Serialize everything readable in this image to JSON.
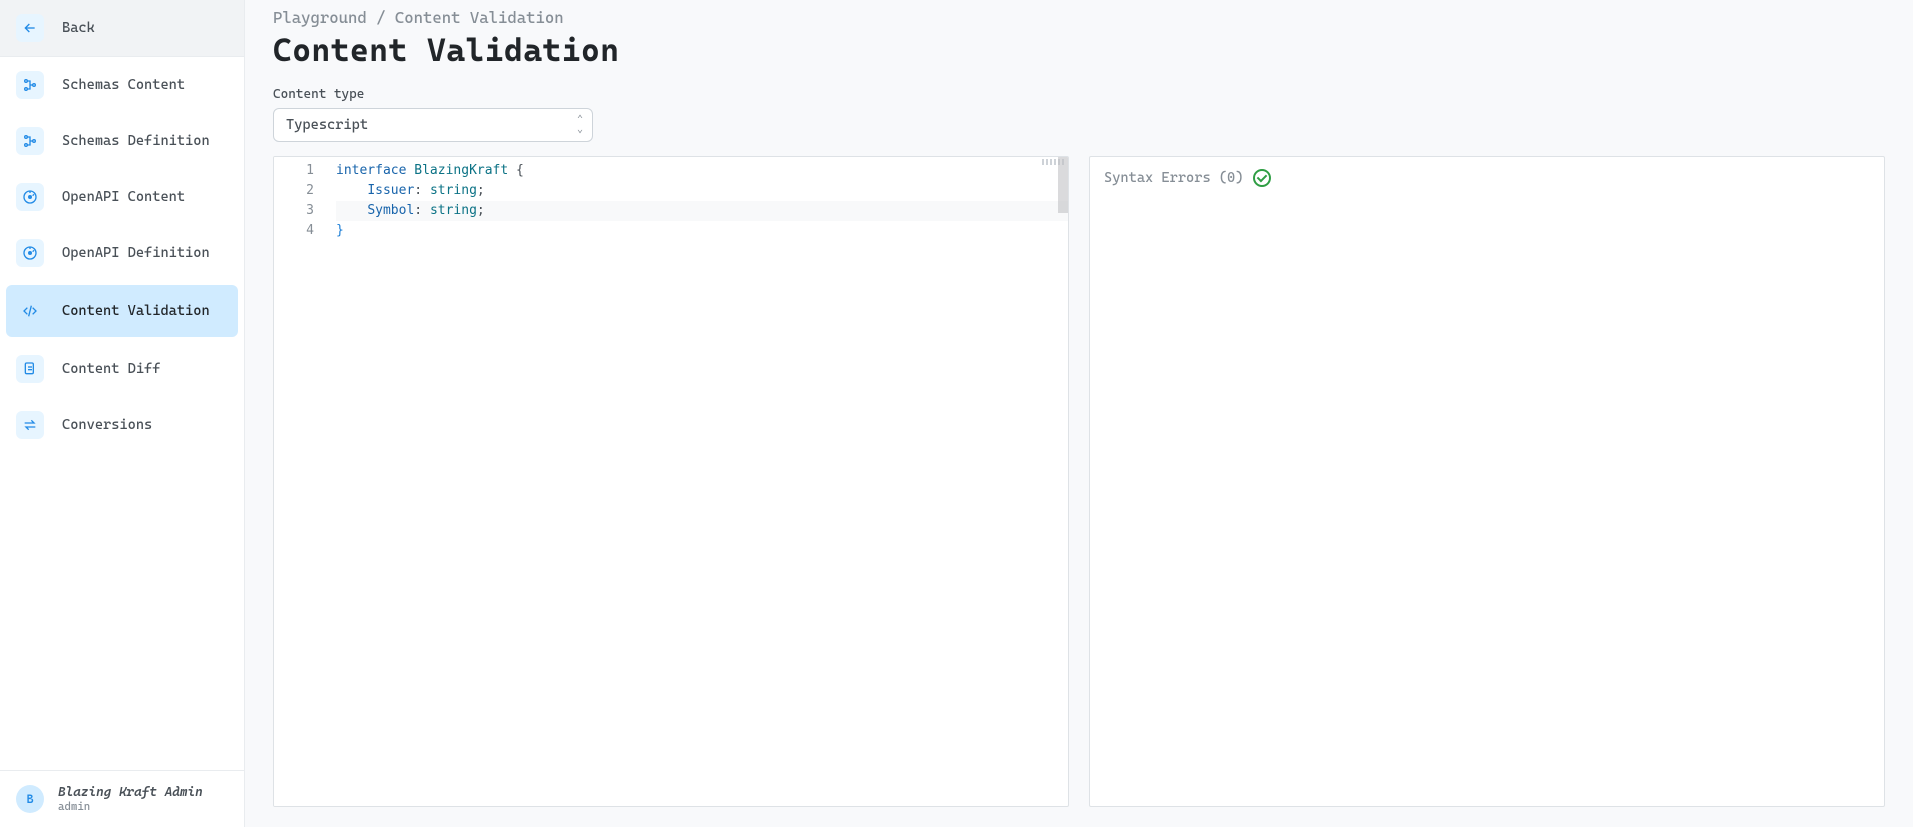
{
  "sidebar": {
    "back_label": "Back",
    "items": [
      {
        "label": "Schemas Content",
        "icon": "schema-icon"
      },
      {
        "label": "Schemas Definition",
        "icon": "schema-icon"
      },
      {
        "label": "OpenAPI Content",
        "icon": "openapi-icon"
      },
      {
        "label": "OpenAPI Definition",
        "icon": "openapi-icon"
      },
      {
        "label": "Content Validation",
        "icon": "code-icon",
        "active": true
      },
      {
        "label": "Content Diff",
        "icon": "diff-icon"
      },
      {
        "label": "Conversions",
        "icon": "swap-icon"
      }
    ]
  },
  "user": {
    "name": "Blazing Kraft Admin",
    "role": "admin",
    "initial": "B"
  },
  "breadcrumb": "Playground / Content Validation",
  "title": "Content Validation",
  "content_type": {
    "label": "Content type",
    "value": "Typescript"
  },
  "editor": {
    "lines": [
      "1",
      "2",
      "3",
      "4"
    ],
    "tokens": [
      [
        {
          "t": "interface",
          "c": "kw"
        },
        {
          "t": " ",
          "c": ""
        },
        {
          "t": "BlazingKraft",
          "c": "type"
        },
        {
          "t": " ",
          "c": ""
        },
        {
          "t": "{",
          "c": "punct"
        }
      ],
      [
        {
          "t": "    ",
          "c": ""
        },
        {
          "t": "Issuer",
          "c": "prop"
        },
        {
          "t": ": ",
          "c": "punct"
        },
        {
          "t": "string",
          "c": "typeval"
        },
        {
          "t": ";",
          "c": "punct"
        }
      ],
      [
        {
          "t": "    ",
          "c": ""
        },
        {
          "t": "Symbol",
          "c": "prop"
        },
        {
          "t": ": ",
          "c": "punct"
        },
        {
          "t": "string",
          "c": "typeval"
        },
        {
          "t": ";",
          "c": "punct"
        }
      ],
      [
        {
          "t": "}",
          "c": "brace"
        }
      ]
    ]
  },
  "errors": {
    "label": "Syntax Errors",
    "count": 0
  }
}
